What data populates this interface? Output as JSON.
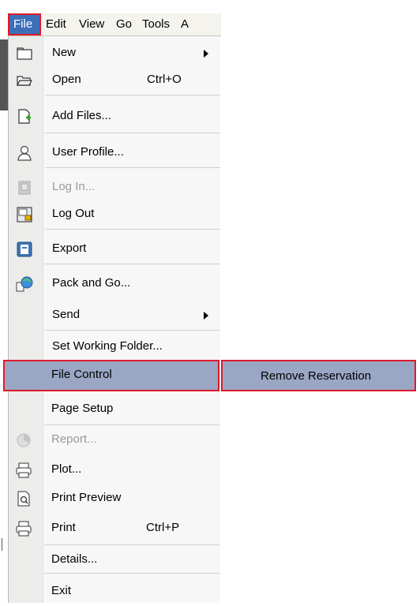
{
  "menubar": {
    "items": [
      "File",
      "Edit",
      "View",
      "Go",
      "Tools",
      "A"
    ]
  },
  "file_menu": {
    "items": [
      {
        "label": "New",
        "icon": "folder-empty-icon",
        "submenu": true
      },
      {
        "label": "Open",
        "icon": "open-folder-icon",
        "shortcut": "Ctrl+O"
      },
      {
        "label": "Add Files...",
        "icon": "add-file-icon"
      },
      {
        "label": "User Profile...",
        "icon": "user-icon"
      },
      {
        "label": "Log In...",
        "icon": "login-icon",
        "disabled": true
      },
      {
        "label": "Log Out",
        "icon": "logout-icon"
      },
      {
        "label": "Export",
        "icon": "export-icon"
      },
      {
        "label": "Pack and Go...",
        "icon": "pack-and-go-icon"
      },
      {
        "label": "Send",
        "submenu": true
      },
      {
        "label": "Set Working Folder..."
      },
      {
        "label": "File Control",
        "highlighted": true
      },
      {
        "label": "Page Setup"
      },
      {
        "label": "Report...",
        "icon": "report-icon",
        "disabled": true
      },
      {
        "label": "Plot...",
        "icon": "printer-icon"
      },
      {
        "label": "Print Preview",
        "icon": "print-preview-icon"
      },
      {
        "label": "Print",
        "icon": "printer-icon",
        "shortcut": "Ctrl+P"
      },
      {
        "label": "Details..."
      },
      {
        "label": "Exit"
      }
    ]
  },
  "submenu": {
    "file_control": {
      "items": [
        "Remove Reservation"
      ]
    }
  },
  "colors": {
    "highlight_outline": "#e0192a",
    "selected_bg": "#99a7c4",
    "menu_selected": "#3d6fb8"
  }
}
